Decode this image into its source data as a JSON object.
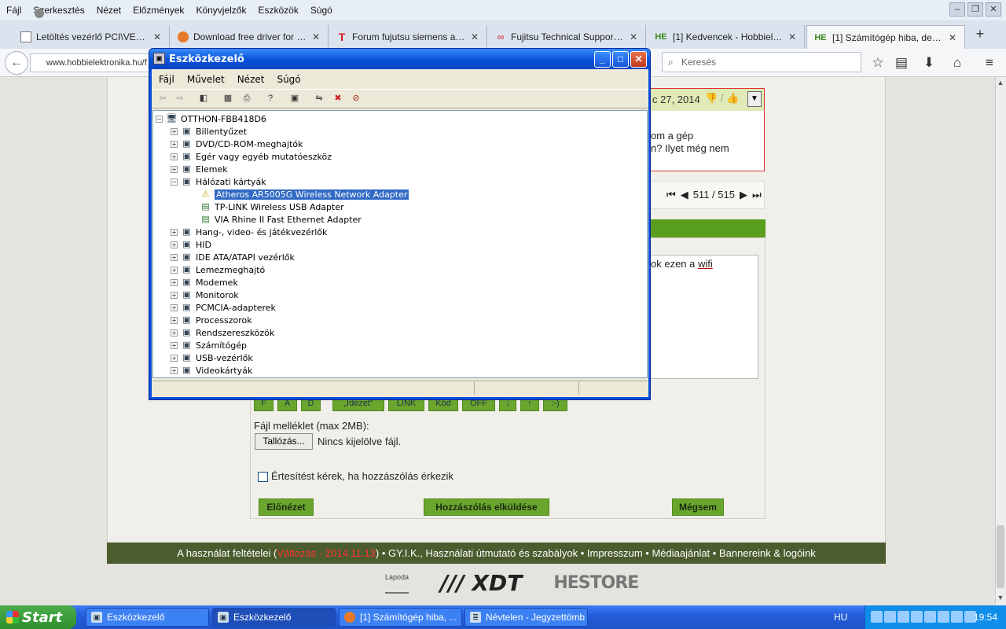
{
  "firefox": {
    "menu": [
      "Fájl",
      "Szerkesztés",
      "Nézet",
      "Előzmények",
      "Könyvjelzők",
      "Eszközök",
      "Súgó"
    ],
    "tabs": [
      {
        "title": "Letöltés vezérlő PCI\\VEN_1..."
      },
      {
        "title": "Download free driver for no..."
      },
      {
        "title": "Forum fujutsu siemens amilo..."
      },
      {
        "title": "Fujitsu Technical Support pa..."
      },
      {
        "title": "[1] Kedvencek - Hobbielektr..."
      },
      {
        "title": "[1] Számítógép hiba, de mi ..."
      }
    ],
    "url": "www.hobbielektronika.hu/f",
    "search_placeholder": "Keresés",
    "icons": {
      "back": "back-arrow-icon",
      "bookmark": "star-icon",
      "reading": "reading-list-icon",
      "download": "download-icon",
      "home": "home-icon",
      "menu": "hamburger-icon"
    }
  },
  "page": {
    "post_date": "c 27, 2014",
    "post_line1": "om a gép",
    "post_line2": "n? Ilyet még nem",
    "pager": "511 / 515",
    "reply_text": "ok ezen a",
    "reply_link": "wifi",
    "format_buttons": [
      "F",
      "A",
      "D",
      "„Idézet”",
      "LINK",
      "Kód",
      "OFF",
      "↓",
      "↑",
      ":-)"
    ],
    "attach_label": "Fájl melléklet (max 2MB):",
    "browse_label": "Tallózás...",
    "no_file": "Nincs kijelölve fájl.",
    "notify_label": "Értesítést kérek, ha hozzászólás érkezik",
    "preview_btn": "Előnézet",
    "submit_btn": "Hozzászólás elküldése",
    "cancel_btn": "Mégsem",
    "footer_pre": "A használat feltételei (",
    "footer_change": "Változás - 2014.11.13",
    "footer_post": ") • GY.I.K., Használati útmutató és szabályok • Impresszum • Médiaajánlat • Bannereink & logóink",
    "logo1": "Lapoda",
    "logo2": "/// XDT",
    "logo3": "HESTORE"
  },
  "device_manager": {
    "title": "Eszközkezelő",
    "menu": [
      "Fájl",
      "Művelet",
      "Nézet",
      "Súgó"
    ],
    "root": "OTTHON-FBB418D6",
    "categories": [
      {
        "label": "Billentyűzet",
        "expanded": false
      },
      {
        "label": "DVD/CD-ROM-meghajtók",
        "expanded": false
      },
      {
        "label": "Egér vagy egyéb mutatóeszköz",
        "expanded": false
      },
      {
        "label": "Elemek",
        "expanded": false
      },
      {
        "label": "Hálózati kártyák",
        "expanded": true,
        "children": [
          {
            "label": "Atheros AR5005G Wireless Network Adapter",
            "selected": true,
            "warning": true
          },
          {
            "label": "TP-LINK Wireless USB Adapter"
          },
          {
            "label": "VIA Rhine II Fast Ethernet Adapter"
          }
        ]
      },
      {
        "label": "Hang-, video- és játékvezérlők",
        "expanded": false
      },
      {
        "label": "HID",
        "expanded": false
      },
      {
        "label": "IDE ATA/ATAPI vezérlők",
        "expanded": false
      },
      {
        "label": "Lemezmeghajtó",
        "expanded": false
      },
      {
        "label": "Modemek",
        "expanded": false
      },
      {
        "label": "Monitorok",
        "expanded": false
      },
      {
        "label": "PCMCIA-adapterek",
        "expanded": false
      },
      {
        "label": "Processzorok",
        "expanded": false
      },
      {
        "label": "Rendszereszközök",
        "expanded": false
      },
      {
        "label": "Számítógép",
        "expanded": false
      },
      {
        "label": "USB-vezérlők",
        "expanded": false
      },
      {
        "label": "Videokártyák",
        "expanded": false
      }
    ]
  },
  "taskbar": {
    "start": "Start",
    "tasks": [
      {
        "label": "Eszközkezelő"
      },
      {
        "label": "Eszközkezelő"
      },
      {
        "label": "[1] Számítógép hiba, ..."
      },
      {
        "label": "Névtelen - Jegyzettömb"
      }
    ],
    "lang": "HU",
    "clock": "19:54"
  }
}
